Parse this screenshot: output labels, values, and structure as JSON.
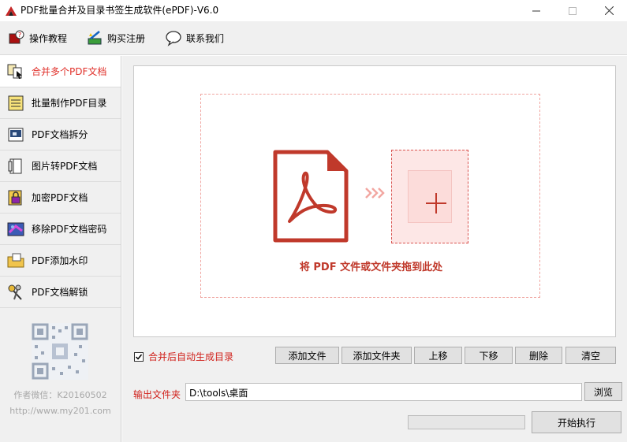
{
  "window": {
    "title": "PDF批量合并及目录书签生成软件(ePDF)-V6.0",
    "controls": [
      "minimize",
      "maximize",
      "close"
    ]
  },
  "toolbar": {
    "items": [
      {
        "label": "操作教程",
        "icon": "help-book-icon"
      },
      {
        "label": "购买注册",
        "icon": "register-pen-icon"
      },
      {
        "label": "联系我们",
        "icon": "speech-bubble-icon"
      }
    ]
  },
  "sidebar": {
    "items": [
      {
        "label": "合并多个PDF文档",
        "icon": "merge-documents-icon",
        "active": true
      },
      {
        "label": "批量制作PDF目录",
        "icon": "folder-toc-icon",
        "active": false
      },
      {
        "label": "PDF文档拆分",
        "icon": "split-document-icon",
        "active": false
      },
      {
        "label": "图片转PDF文档",
        "icon": "image-to-pdf-icon",
        "active": false
      },
      {
        "label": "加密PDF文档",
        "icon": "encrypt-icon",
        "active": false
      },
      {
        "label": "移除PDF文档密码",
        "icon": "remove-password-icon",
        "active": false
      },
      {
        "label": "PDF添加水印",
        "icon": "watermark-folder-icon",
        "active": false
      },
      {
        "label": "PDF文档解锁",
        "icon": "unlock-keys-icon",
        "active": false
      }
    ],
    "author_wechat": "作者微信：K20160502",
    "author_url": "http://www.my201.com"
  },
  "dropzone": {
    "text": "将 PDF 文件或文件夹拖到此处",
    "accent_color": "#c0392b"
  },
  "options": {
    "auto_toc_label": "合并后自动生成目录",
    "auto_toc_checked": true
  },
  "actions": {
    "add_file": "添加文件",
    "add_folder": "添加文件夹",
    "move_up": "上移",
    "move_down": "下移",
    "delete": "删除",
    "clear": "清空"
  },
  "output": {
    "label": "输出文件夹",
    "path": "D:\\tools\\桌面",
    "browse": "浏览"
  },
  "progress": {
    "value": 0
  },
  "start_button": "开始执行"
}
